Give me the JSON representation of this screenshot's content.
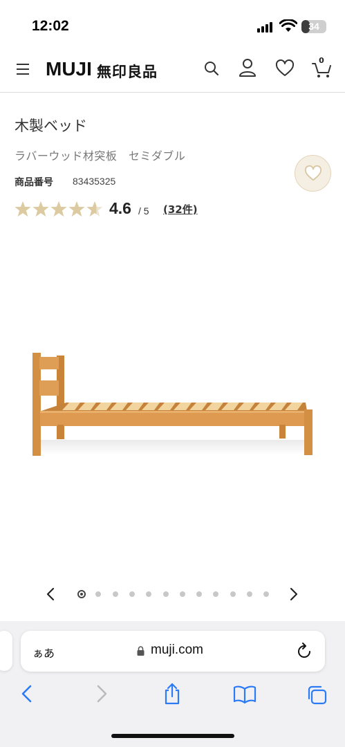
{
  "status_bar": {
    "time": "12:02",
    "battery": "34",
    "battery_level": 0.34
  },
  "header": {
    "logo_text": "MUJI",
    "logo_kanji": "無印良品",
    "cart_count": "0"
  },
  "product": {
    "title": "木製ベッド",
    "subtitle": "ラバーウッド材突板　セミダブル",
    "number_label": "商品番号",
    "number_value": "83435325",
    "rating_value": "4.6",
    "rating_max": "/ 5",
    "rating_stars": 4.6,
    "review_count": "(32件)"
  },
  "carousel": {
    "total": 12,
    "active_index": 0
  },
  "browser": {
    "text_size_label": "ぁあ",
    "url": "muji.com"
  },
  "colors": {
    "star": "#dccaa0",
    "wood": "#d9964b",
    "slat": "#f2d49e",
    "fav_bg": "#f5efe3",
    "safari_blue": "#2b7bf6"
  },
  "icons": [
    "menu-icon",
    "search-icon",
    "user-icon",
    "heart-icon",
    "cart-icon",
    "lock-icon",
    "reload-icon",
    "back-icon",
    "forward-icon",
    "share-icon",
    "bookmarks-icon",
    "tabs-icon"
  ]
}
